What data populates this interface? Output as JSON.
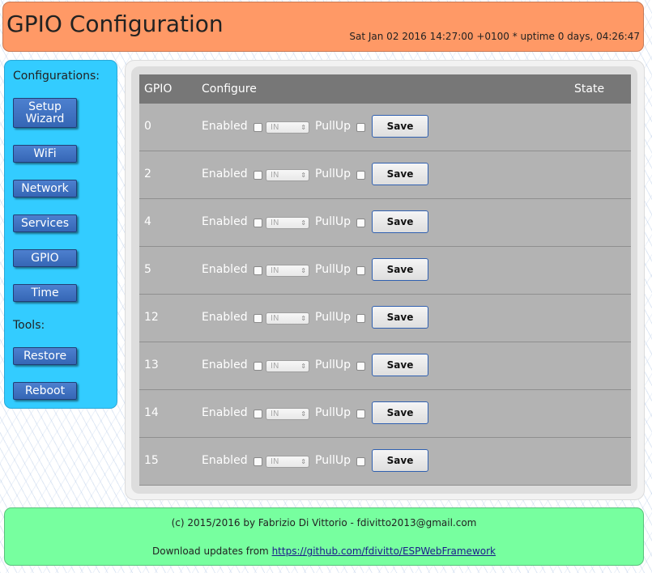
{
  "header": {
    "title": "GPIO Configuration",
    "status": "Sat Jan 02 2016 14:27:00 +0100 * uptime 0 days, 04:26:47"
  },
  "sidebar": {
    "configurations_label": "Configurations:",
    "tools_label": "Tools:",
    "config_items": [
      {
        "label": "Setup Wizard"
      },
      {
        "label": "WiFi"
      },
      {
        "label": "Network"
      },
      {
        "label": "Services"
      },
      {
        "label": "GPIO"
      },
      {
        "label": "Time"
      }
    ],
    "tool_items": [
      {
        "label": "Restore"
      },
      {
        "label": "Reboot"
      }
    ]
  },
  "table": {
    "headers": {
      "gpio": "GPIO",
      "configure": "Configure",
      "state": "State"
    },
    "enabled_label": "Enabled",
    "mode_value": "IN",
    "pullup_label": "PullUp",
    "save_label": "Save",
    "rows": [
      {
        "gpio": "0",
        "enabled": false,
        "mode": "IN",
        "pullup": false,
        "state": ""
      },
      {
        "gpio": "2",
        "enabled": false,
        "mode": "IN",
        "pullup": false,
        "state": ""
      },
      {
        "gpio": "4",
        "enabled": false,
        "mode": "IN",
        "pullup": false,
        "state": ""
      },
      {
        "gpio": "5",
        "enabled": false,
        "mode": "IN",
        "pullup": false,
        "state": ""
      },
      {
        "gpio": "12",
        "enabled": false,
        "mode": "IN",
        "pullup": false,
        "state": ""
      },
      {
        "gpio": "13",
        "enabled": false,
        "mode": "IN",
        "pullup": false,
        "state": ""
      },
      {
        "gpio": "14",
        "enabled": false,
        "mode": "IN",
        "pullup": false,
        "state": ""
      },
      {
        "gpio": "15",
        "enabled": false,
        "mode": "IN",
        "pullup": false,
        "state": ""
      }
    ]
  },
  "footer": {
    "copyright": "(c) 2015/2016 by Fabrizio Di Vittorio - fdivitto2013@gmail.com",
    "download_prefix": "Download updates from ",
    "download_link": "https://github.com/fdivitto/ESPWebFramework"
  },
  "colors": {
    "header_bg": "#ff9966",
    "sidebar_bg": "#33ccff",
    "footer_bg": "#77ff9f",
    "nav_button": "#3e72c4",
    "table_header": "#777777",
    "table_row": "#b3b3b3"
  }
}
